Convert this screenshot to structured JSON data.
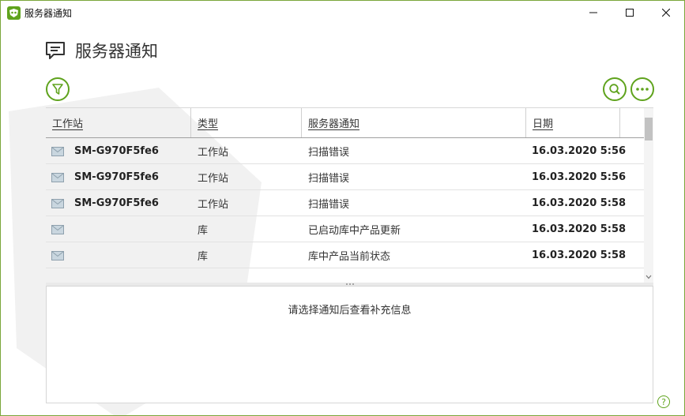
{
  "window": {
    "title": "服务器通知"
  },
  "header": {
    "title": "服务器通知"
  },
  "table": {
    "columns": [
      "工作站",
      "类型",
      "服务器通知",
      "日期"
    ],
    "rows": [
      {
        "device": "SM-G970F5fe6",
        "type": "工作站",
        "notification": "扫描错误",
        "date": "16.03.2020 5:56",
        "icon": "envelope-icon"
      },
      {
        "device": "SM-G970F5fe6",
        "type": "工作站",
        "notification": "扫描错误",
        "date": "16.03.2020 5:56",
        "icon": "envelope-icon"
      },
      {
        "device": "SM-G970F5fe6",
        "type": "工作站",
        "notification": "扫描错误",
        "date": "16.03.2020 5:58",
        "icon": "envelope-icon"
      },
      {
        "device": "",
        "type": "库",
        "notification": "已启动库中产品更新",
        "date": "16.03.2020 5:58",
        "icon": "envelope-icon"
      },
      {
        "device": "",
        "type": "库",
        "notification": "库中产品当前状态",
        "date": "16.03.2020 5:58",
        "icon": "envelope-icon"
      }
    ]
  },
  "details": {
    "text": "请选择通知后查看补充信息"
  },
  "help": {
    "label": "?"
  },
  "colors": {
    "accent": "#5fa31d",
    "border": "#7aa63b"
  }
}
